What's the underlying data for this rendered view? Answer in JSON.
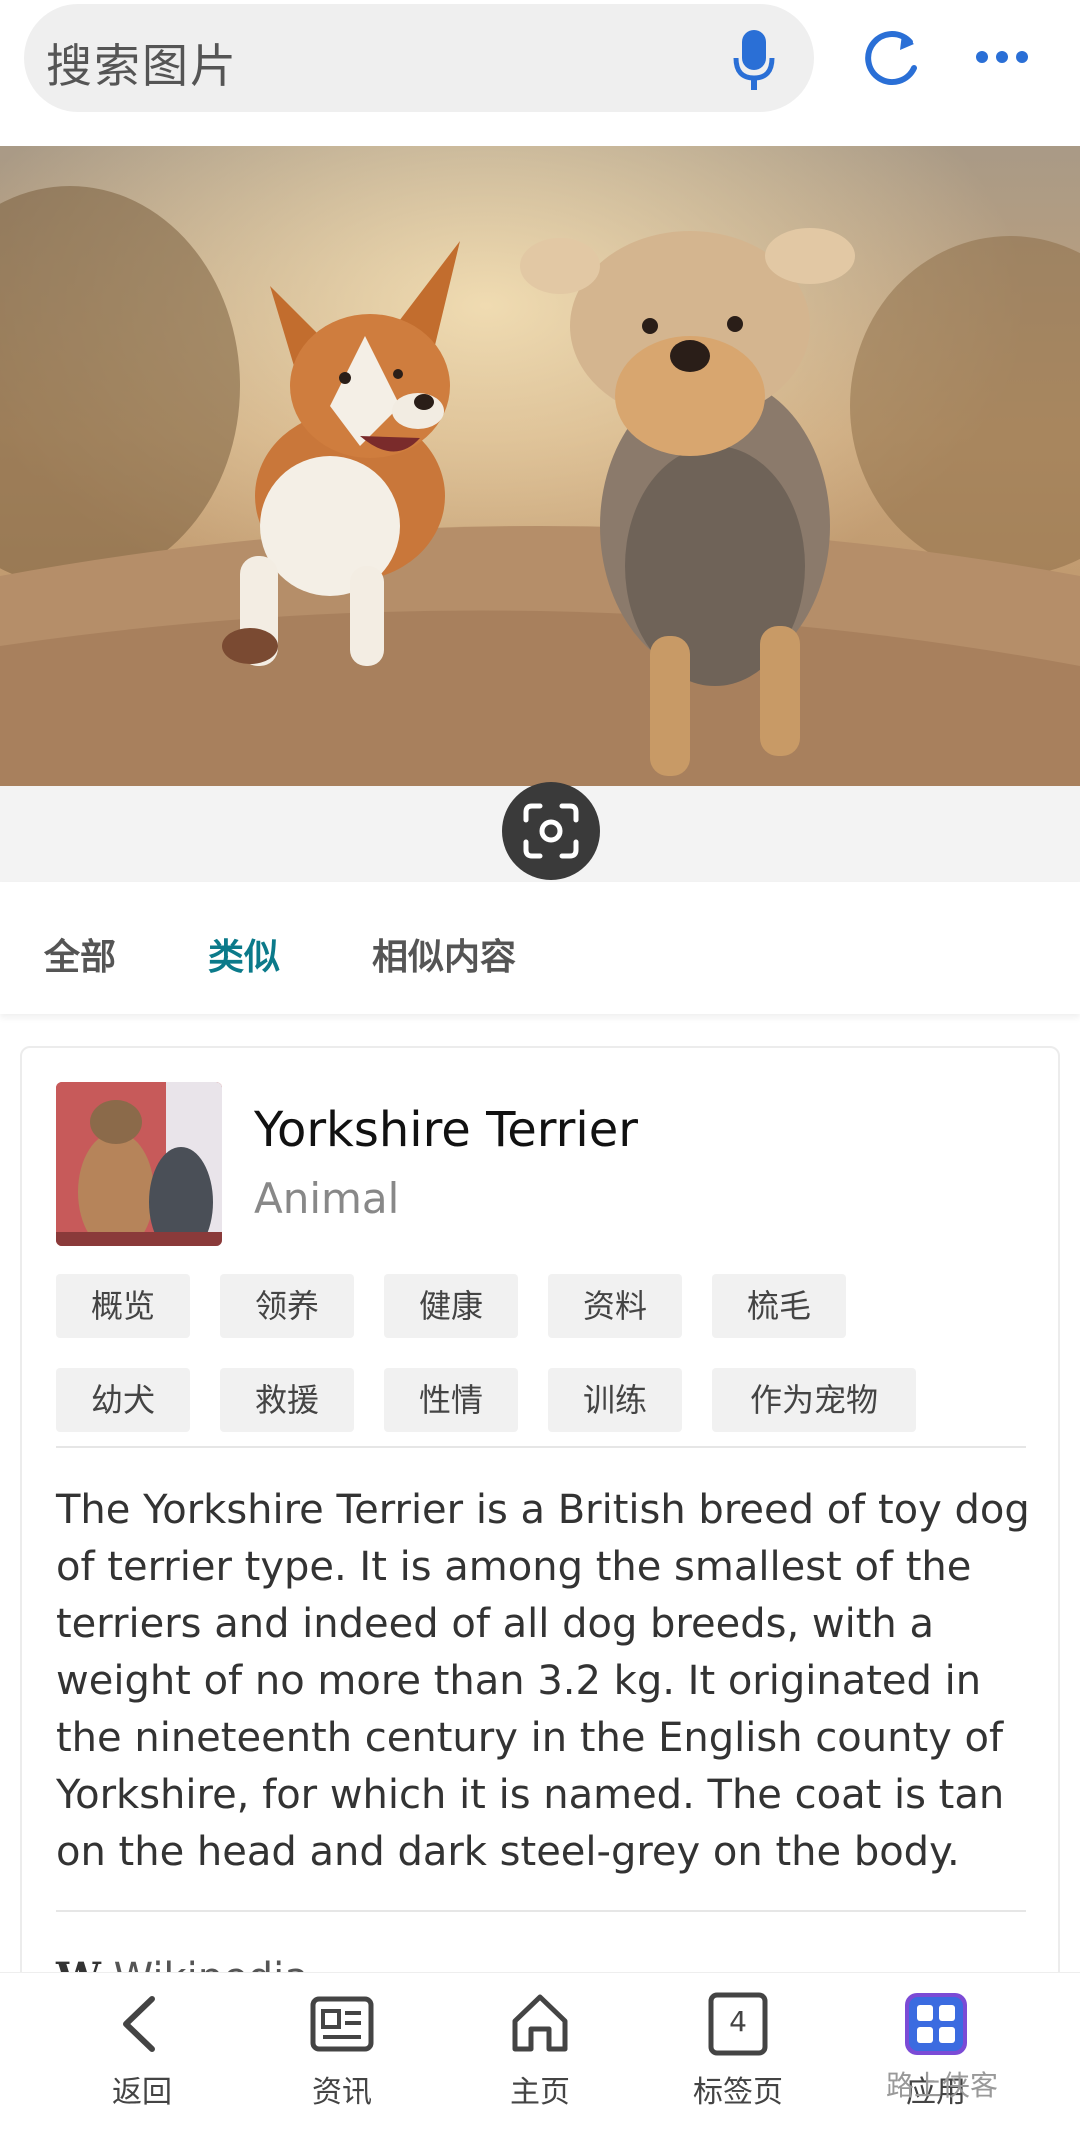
{
  "search": {
    "placeholder": "搜索图片"
  },
  "tabs": [
    {
      "label": "全部",
      "active": false
    },
    {
      "label": "类似",
      "active": true
    },
    {
      "label": "相似内容",
      "active": false
    }
  ],
  "entity": {
    "title": "Yorkshire Terrier",
    "type": "Animal",
    "chips_row1": [
      "概览",
      "领养",
      "健康",
      "资料",
      "梳毛"
    ],
    "chips_row2": [
      "幼犬",
      "救援",
      "性情",
      "训练",
      "作为宠物"
    ],
    "description": "The Yorkshire Terrier is a British breed of toy dog of terrier type. It is among the smallest of the terriers and indeed of all dog breeds, with a weight of no more than 3.2 kg. It originated in the nineteenth century in the English county of Yorkshire, for which it is named. The coat is tan on the head and dark steel-grey on the body.",
    "source_label": "Wikipedia"
  },
  "bottom_nav": [
    {
      "label": "返回",
      "icon": "back-arrow-icon"
    },
    {
      "label": "资讯",
      "icon": "news-icon"
    },
    {
      "label": "主页",
      "icon": "home-icon"
    },
    {
      "label": "标签页",
      "icon": "tabs-icon",
      "count": "4"
    },
    {
      "label": "应用",
      "icon": "apps-icon"
    }
  ],
  "watermark": "路上侠客",
  "colors": {
    "accent": "#0b7a8a",
    "icon_blue": "#2a6fd6"
  }
}
